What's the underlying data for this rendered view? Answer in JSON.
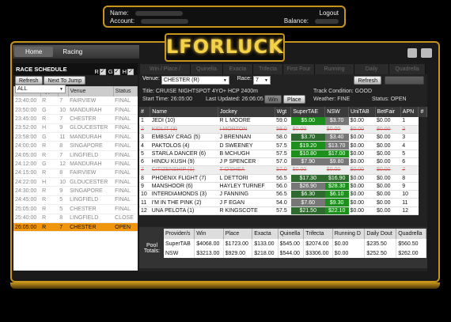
{
  "account": {
    "name_label": "Name:",
    "account_label": "Account:",
    "balance_label": "Balance:",
    "logout": "Logout"
  },
  "logo": "LFORLUCK",
  "breadcrumb": {
    "home": "Home",
    "current": "Racing"
  },
  "schedule": {
    "title": "RACE SCHEDULE",
    "filters": [
      "R",
      "G",
      "H"
    ],
    "refresh": "Refresh",
    "next": "Next To Jump",
    "filter_value": "ALL",
    "columns": [
      "Time",
      "Type",
      "#",
      "Venue",
      "Status"
    ],
    "rows": [
      [
        "23:40:00",
        "R",
        "7",
        "FAIRVIEW",
        "FINAL"
      ],
      [
        "23:50:00",
        "G",
        "10",
        "MANDURAH",
        "FINAL"
      ],
      [
        "23:45:00",
        "R",
        "7",
        "CHESTER",
        "FINAL"
      ],
      [
        "23:52:00",
        "H",
        "9",
        "GLOUCESTER",
        "FINAL"
      ],
      [
        "23:58:00",
        "G",
        "11",
        "MANDURAH",
        "FINAL"
      ],
      [
        "24:00:00",
        "R",
        "8",
        "SINGAPORE",
        "FINAL"
      ],
      [
        "24:05:00",
        "R",
        "7",
        "LINGFIELD",
        "FINAL"
      ],
      [
        "24:12:00",
        "G",
        "12",
        "MANDURAH",
        "FINAL"
      ],
      [
        "24:15:00",
        "R",
        "8",
        "FAIRVIEW",
        "FINAL"
      ],
      [
        "24:22:00",
        "H",
        "10",
        "GLOUCESTER",
        "FINAL"
      ],
      [
        "24:30:00",
        "R",
        "9",
        "SINGAPORE",
        "FINAL"
      ],
      [
        "24:45:00",
        "R",
        "5",
        "LINGFIELD",
        "FINAL"
      ],
      [
        "25:05:00",
        "R",
        "5",
        "CHESTER",
        "FINAL"
      ],
      [
        "25:40:00",
        "R",
        "8",
        "LINGFIELD",
        "CLOSE"
      ],
      [
        "26:05:00",
        "R",
        "7",
        "CHESTER",
        "OPEN"
      ]
    ]
  },
  "tabs": [
    "Win / Place / Eachway",
    "Quinella",
    "Exacta",
    "Trifecta",
    "First Four",
    "Running Double",
    "Daily Double",
    "Quadrella"
  ],
  "race": {
    "venue_label": "Venue:",
    "venue": "CHESTER (R)",
    "race_label": "Race:",
    "race": "7",
    "refresh": "Refresh",
    "title": "Title:  CRUISE NIGHTSPOT 4YO+ HCP 2400m",
    "start": "Start Time:  26:05:00",
    "updated": "Last Updated:  26:06:05",
    "win": "Win",
    "place": "Place",
    "track": "Track Condition:  GOOD",
    "weather": "Weather:  FINE",
    "status": "Status:  OPEN"
  },
  "runners": {
    "columns": [
      "#",
      "Name",
      "Jockey",
      "Wgt",
      "SuperTAE",
      "NSW",
      "UniTAB",
      "BetFair",
      "APN",
      "#"
    ],
    "rows": [
      [
        "1",
        "JEDI (10)",
        "R L MOORE",
        "59.0",
        "$5.00",
        "$3.70",
        "$0.00",
        "$0.00",
        "1"
      ],
      [
        "2",
        "KIDLIT (3)",
        "I MORTON",
        "58.0",
        "$0.00",
        "$0.00",
        "$0.00",
        "$0.00",
        "2"
      ],
      [
        "3",
        "EMBSAY CRAG (5)",
        "J BRENNAN",
        "58.0",
        "$3.70",
        "$3.40",
        "$0.00",
        "$0.00",
        "3"
      ],
      [
        "4",
        "PAKTOLOS (4)",
        "D SWEENEY",
        "57.5",
        "$19.20",
        "$13.70",
        "$0.00",
        "$0.00",
        "4"
      ],
      [
        "5",
        "STARLA DANCER (6)",
        "B MCHUGH",
        "57.5",
        "$10.80",
        "$17.00",
        "$0.00",
        "$0.00",
        "5"
      ],
      [
        "6",
        "HINDU KUSH (9)",
        "J P SPENCER",
        "57.0",
        "$7.90",
        "$9.80",
        "$0.00",
        "$0.00",
        "6"
      ],
      [
        "7",
        "CITIZENSHIP (1)",
        "T O'SHEA",
        "57.0",
        "$0.00",
        "$0.00",
        "$0.00",
        "$0.00",
        "7"
      ],
      [
        "8",
        "PHOENIX FLIGHT (7)",
        "L DETTORI",
        "56.5",
        "$17.30",
        "$16.90",
        "$0.00",
        "$0.00",
        "8"
      ],
      [
        "9",
        "MANSHOOR (6)",
        "HAYLEY TURNEF",
        "56.0",
        "$26.90",
        "$28.30",
        "$0.00",
        "$0.00",
        "9"
      ],
      [
        "10",
        "INTERDIAMONDS (3)",
        "J FANNING",
        "56.5",
        "$6.30",
        "$6.10",
        "$0.00",
        "$0.00",
        "10"
      ],
      [
        "11",
        "I'M IN THE PINK (2)",
        "J F EGAN",
        "54.0",
        "$7.60",
        "$9.30",
        "$0.00",
        "$0.00",
        "11"
      ],
      [
        "12",
        "UNA PELOTA (1)",
        "R KINGSCOTE",
        "57.5",
        "$21.50",
        "$22.10",
        "$0.00",
        "$0.00",
        "12"
      ]
    ]
  },
  "pools": {
    "label": "Pool Totals:",
    "columns": [
      "Provider/s",
      "Win",
      "Place",
      "Exacta",
      "Quinella",
      "Trifecta",
      "Running D",
      "Daily Dout",
      "Quadrella"
    ],
    "rows": [
      [
        "SuperTAB",
        "$4068.00",
        "$1723.00",
        "$133.00",
        "$545.00",
        "$2074.00",
        "$0.00",
        "$235.50",
        "$560.50"
      ],
      [
        "NSW",
        "$3213.00",
        "$929.00",
        "$218.00",
        "$544.00",
        "$3306.00",
        "$0.00",
        "$252.50",
        "$262.00"
      ]
    ]
  }
}
